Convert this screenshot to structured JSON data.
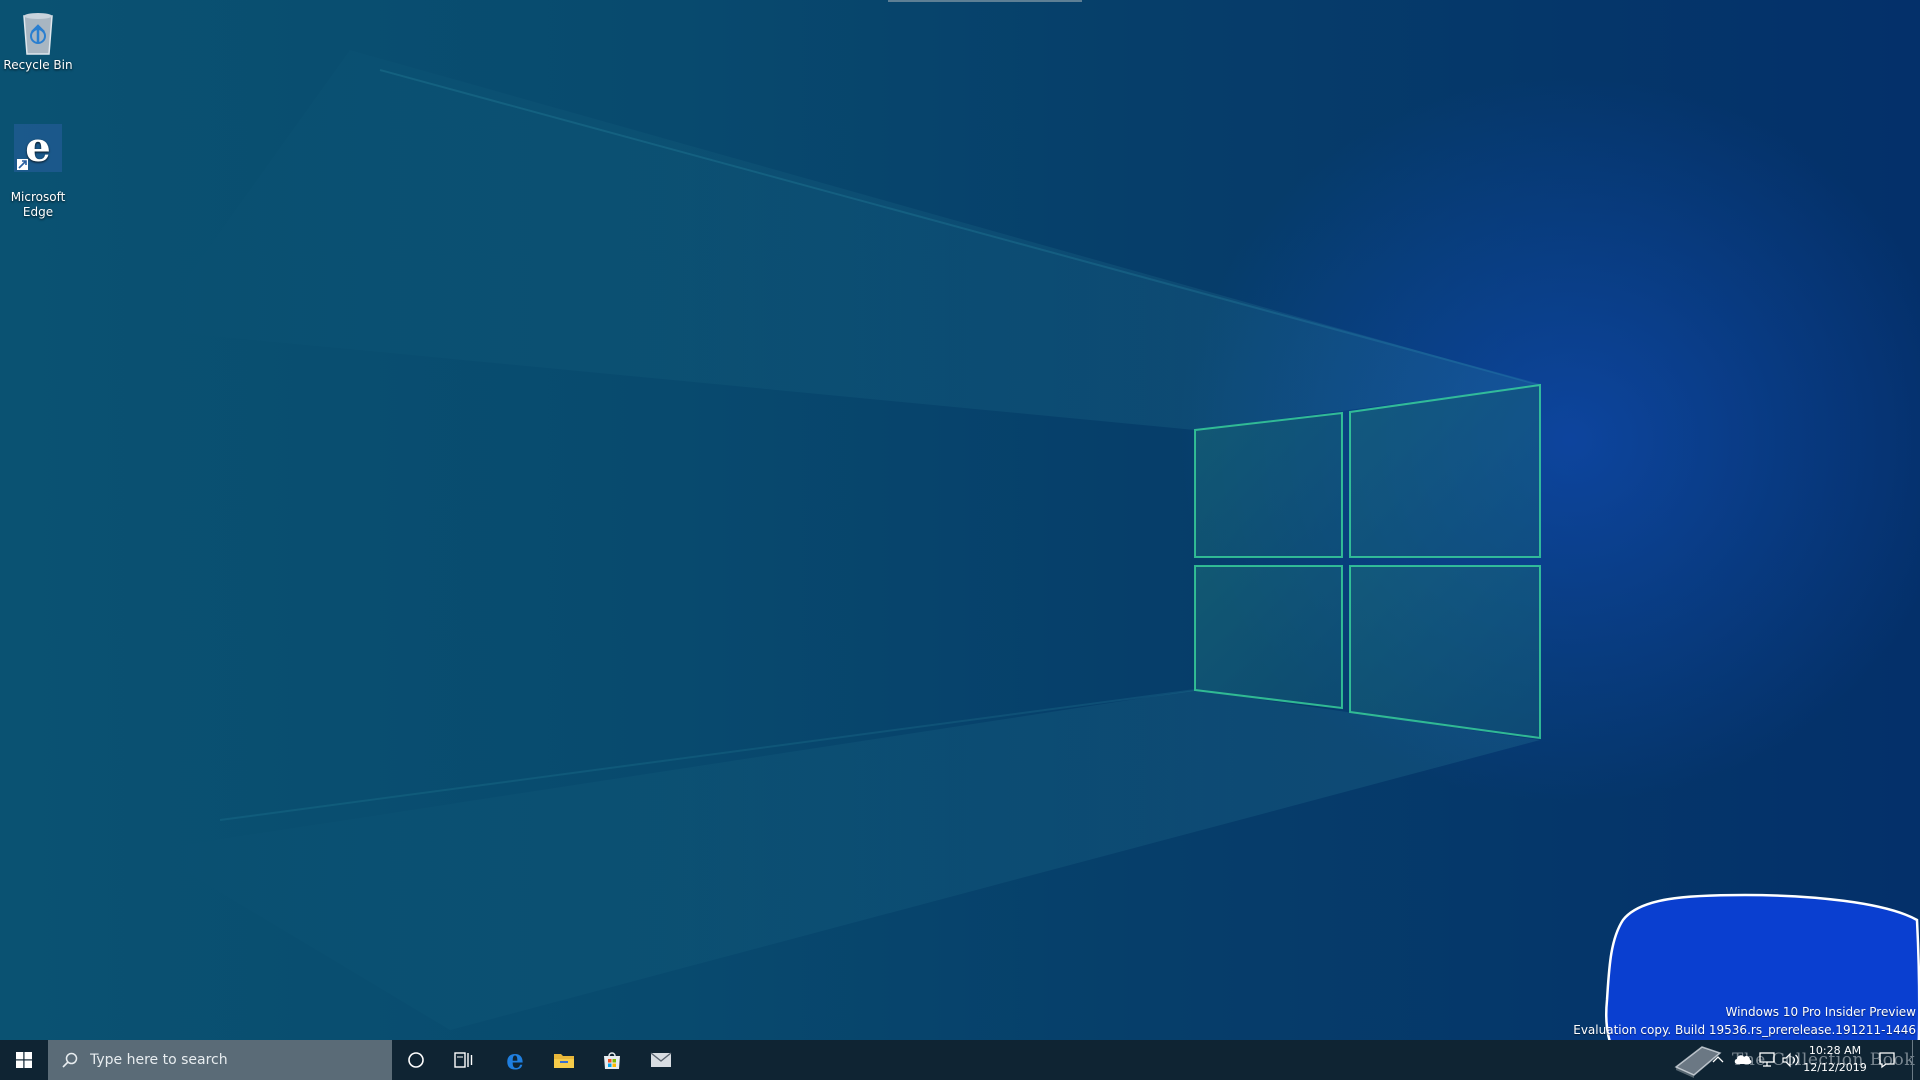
{
  "desktop": {
    "icons": [
      {
        "label": "Recycle Bin",
        "icon": "recycle-bin-icon"
      },
      {
        "label": "Microsoft\nEdge",
        "icon": "edge-icon"
      }
    ]
  },
  "taskbar": {
    "search_placeholder": "Type here to search",
    "pinned": [
      "start-icon",
      "cortana-icon",
      "task-view-icon",
      "edge-icon",
      "file-explorer-icon",
      "store-icon",
      "mail-icon"
    ]
  },
  "watermark": {
    "line1": "Windows 10 Pro Insider Preview",
    "line2": "Evaluation copy. Build 19536.rs_prerelease.191211-1446"
  },
  "overlay_watermark": {
    "text": "The Collection Book"
  },
  "tray": {
    "time": "10:28 AM",
    "date": "12/12/2019",
    "icons": [
      "chevron-up-icon",
      "onedrive-icon",
      "network-icon",
      "volume-icon",
      "notification-icon"
    ]
  },
  "colors": {
    "taskbar": "#0f2433",
    "search_box": "#5a6b77",
    "annotation_blue": "#0a3fd0",
    "logo_edge": "#38e0a0"
  }
}
